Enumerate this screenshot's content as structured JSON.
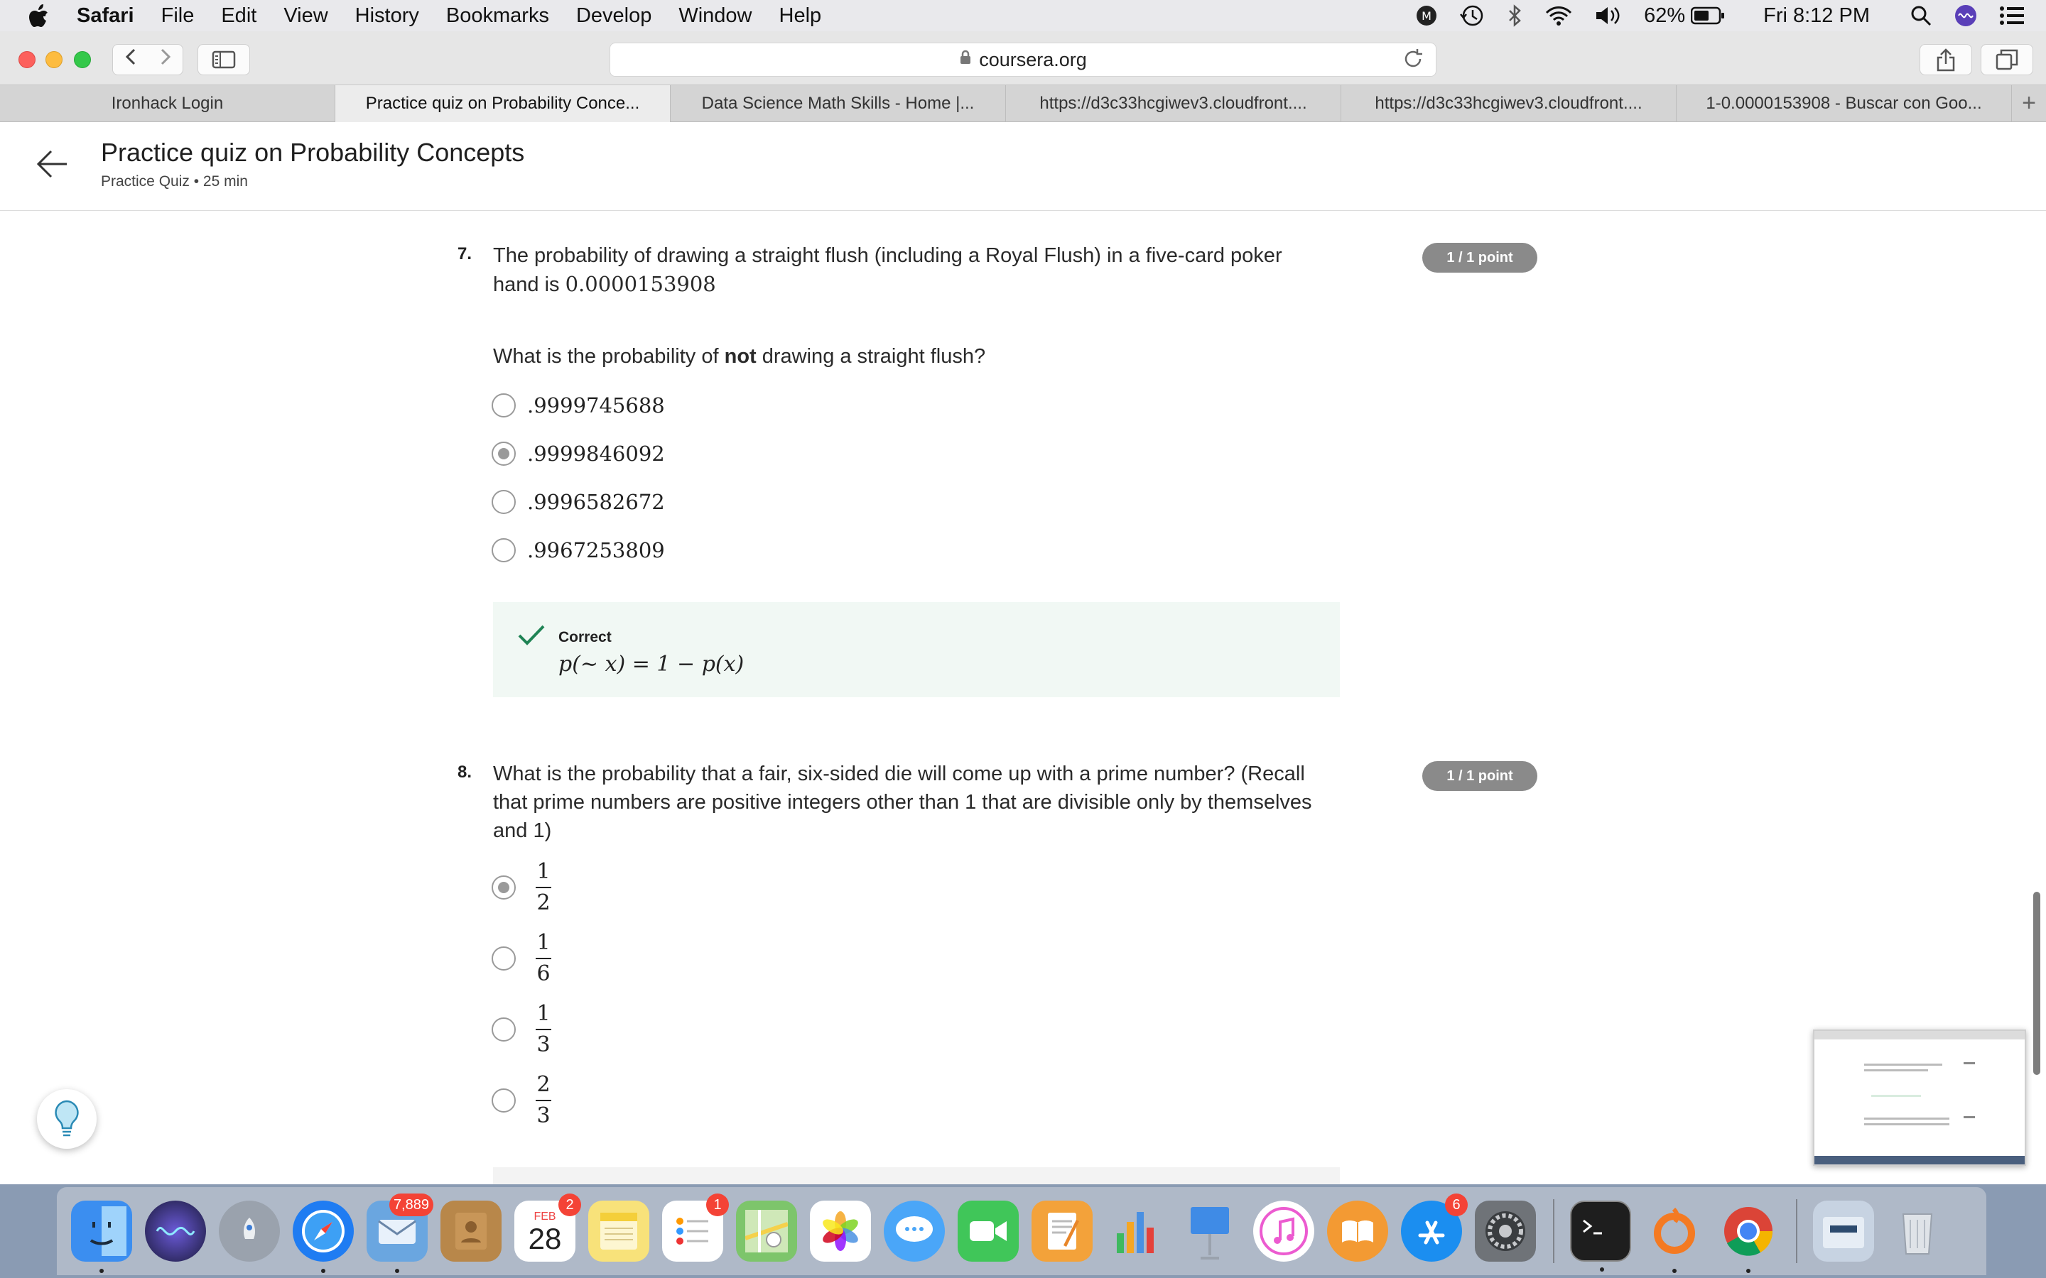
{
  "menubar": {
    "app_name": "Safari",
    "menus": [
      "File",
      "Edit",
      "View",
      "History",
      "Bookmarks",
      "Develop",
      "Window",
      "Help"
    ],
    "battery": "62%",
    "clock": "Fri 8:12 PM"
  },
  "browser": {
    "url": "coursera.org",
    "tabs": [
      {
        "title": "Ironhack Login"
      },
      {
        "title": "Practice quiz on Probability Conce..."
      },
      {
        "title": "Data Science Math Skills - Home |..."
      },
      {
        "title": "https://d3c33hcgiwev3.cloudfront...."
      },
      {
        "title": "https://d3c33hcgiwev3.cloudfront...."
      },
      {
        "title": "1-0.0000153908 - Buscar con Goo..."
      }
    ],
    "active_tab": 1
  },
  "page": {
    "title": "Practice quiz on Probability Concepts",
    "subtitle": "Practice Quiz • 25 min"
  },
  "questions": [
    {
      "number": "7.",
      "text_line1": "The probability of drawing a straight flush (including a Royal Flush) in a five-card poker",
      "text_line2_prefix": "hand is ",
      "text_line2_value": "0.0000153908",
      "points": "1 / 1 point",
      "prompt_before": "What is the probability of ",
      "prompt_bold": "not",
      "prompt_after": " drawing a straight flush?",
      "options": [
        ".9999745688",
        ".9999846092",
        ".9996582672",
        ".9967253809"
      ],
      "selected_index": 1,
      "feedback": {
        "label": "Correct",
        "formula": "p(∼ x) = 1 − p(x)"
      }
    },
    {
      "number": "8.",
      "text": "What is the probability that a fair, six-sided die will come up with a prime number? (Recall that prime numbers are positive integers other than 1 that are divisible only by themselves and 1)",
      "points": "1 / 1 point",
      "options": [
        {
          "num": "1",
          "den": "2"
        },
        {
          "num": "1",
          "den": "6"
        },
        {
          "num": "1",
          "den": "3"
        },
        {
          "num": "2",
          "den": "3"
        }
      ],
      "selected_index": 0
    }
  ],
  "dock": {
    "items": [
      {
        "icon": "finder-icon",
        "color": "#3b8ef0"
      },
      {
        "icon": "siri-icon",
        "color": "#2a2a6a"
      },
      {
        "icon": "launchpad-icon",
        "color": "#9aa2ad"
      },
      {
        "icon": "safari-icon",
        "color": "#1f7cf2"
      },
      {
        "icon": "mail-icon",
        "color": "#6aa6e0",
        "badge": "7,889"
      },
      {
        "icon": "contacts-icon",
        "color": "#b8874a"
      },
      {
        "icon": "calendar-icon",
        "color": "#ffffff",
        "badge": "2",
        "month": "FEB",
        "day": "28"
      },
      {
        "icon": "notes-icon",
        "color": "#f8e27a"
      },
      {
        "icon": "reminders-icon",
        "color": "#ffffff",
        "badge": "1"
      },
      {
        "icon": "maps-icon",
        "color": "#7dc56b"
      },
      {
        "icon": "photos-icon",
        "color": "#ffffff"
      },
      {
        "icon": "messages-icon",
        "color": "#4aa6f8"
      },
      {
        "icon": "facetime-icon",
        "color": "#40c659"
      },
      {
        "icon": "pages-icon",
        "color": "#f3a23a"
      },
      {
        "icon": "numbers-icon",
        "color": "#3eb95f"
      },
      {
        "icon": "keynote-icon",
        "color": "#3f8be6"
      },
      {
        "icon": "itunes-icon",
        "color": "#ec5bd0"
      },
      {
        "icon": "books-icon",
        "color": "#f39a33"
      },
      {
        "icon": "appstore-icon",
        "color": "#1b8ef0",
        "badge": "6"
      },
      {
        "icon": "system-preferences-icon",
        "color": "#6f7378"
      },
      {
        "icon": "terminal-icon",
        "color": "#1e1e1e"
      },
      {
        "icon": "origin-icon",
        "color": "#f47a22"
      },
      {
        "icon": "chrome-icon",
        "color": "#e4e4e4"
      },
      {
        "icon": "downloads-folder-icon",
        "color": "#c7d3e2"
      },
      {
        "icon": "trash-icon",
        "color": "#dfe3e8"
      }
    ]
  }
}
